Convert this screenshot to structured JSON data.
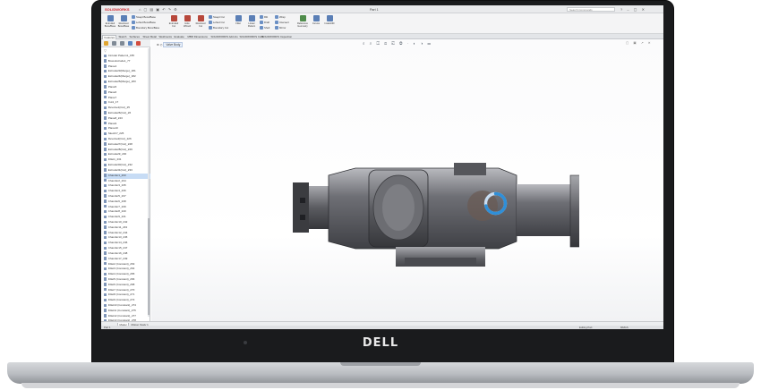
{
  "device": {
    "brand": "DELL"
  },
  "app": {
    "name": "SOLIDWORKS",
    "document_title": "Part 1",
    "search_placeholder": "Search Commands"
  },
  "ribbon": {
    "buttons": [
      "Extruded Boss/Base",
      "Revolved Boss/Base",
      "Extruded Cut",
      "Hole Wizard",
      "Revolved Cut",
      "Fillet",
      "Linear Pattern",
      "Rib",
      "Draft",
      "Shell",
      "Wrap",
      "Intersect",
      "Reference Geometry",
      "Curves",
      "Instant3D"
    ],
    "rows": [
      "Swept Boss/Base",
      "Lofted Boss/Base",
      "Boundary Boss/Base",
      "Swept Cut",
      "Lofted Cut",
      "Boundary Cut",
      "Mirror"
    ]
  },
  "tabs": [
    "Features",
    "Sketch",
    "Surfaces",
    "Sheet Metal",
    "Weldments",
    "Evaluate",
    "MBD Dimensions",
    "SOLIDWORKS Add-Ins",
    "SOLIDWORKS CAM",
    "SOLIDWORKS Inspection"
  ],
  "active_tab": "Features",
  "breadcrumb": "Valve Body",
  "feature_tree": [
    "Circular Pattern1_155",
    "Boss-Extrude1_77",
    "Plane4",
    "Extrude23(Merge)_181",
    "Extrude24(Merge)_182",
    "Extrude25(Merge)_183",
    "Plane5",
    "Plane6",
    "Plane7",
    "Cut1_17",
    "Revolve1(Cut)_25",
    "Extrude26(Cut)_26",
    "Plane8_223",
    "Plane9",
    "Plane10",
    "Sketch7_225",
    "Revolve2(Cut)_226",
    "Extrude27(Cut)_228",
    "Extrude28(Cut)_229",
    "Extrude29_230",
    "Fillet1_231",
    "Extrude30(Cut)_232",
    "Extrude31(Cut)_233",
    "Chamfer1_233",
    "Chamfer2_234",
    "Chamfer3_235",
    "Chamfer4_236",
    "Chamfer5_237",
    "Chamfer6_238",
    "Chamfer7_239",
    "Chamfer8_240",
    "Chamfer9_241",
    "Chamfer10_242",
    "Chamfer11_243",
    "Chamfer12_244",
    "Chamfer13_245",
    "Chamfer14_246",
    "Chamfer15_247",
    "Chamfer16_248",
    "Chamfer17_249",
    "Fillet2 (Constant)_263",
    "Fillet3 (Constant)_264",
    "Fillet4 (Constant)_265",
    "Fillet5 (Constant)_266",
    "Fillet6 (Constant)_268",
    "Fillet7 (Constant)_270",
    "Fillet8 (Constant)_271",
    "Fillet9 (Constant)_272",
    "Fillet10 (Constant)_274",
    "Fillet11 (Constant)_275",
    "Fillet12 (Constant)_277",
    "Fillet13 (Constant)_278",
    "Fillet14 (Constant)_281"
  ],
  "selected_tree_item": "Chamfer1_233",
  "bottom_tabs": [
    "Model",
    "Motion Study 1"
  ],
  "active_bottom_tab": "Model",
  "status": {
    "left": "Part 1",
    "mode": "Editing Part",
    "units": "MMGS"
  },
  "colors": {
    "accent": "#2f8fd8",
    "part": "#5d5e63",
    "selection": "#c7dcf5"
  }
}
